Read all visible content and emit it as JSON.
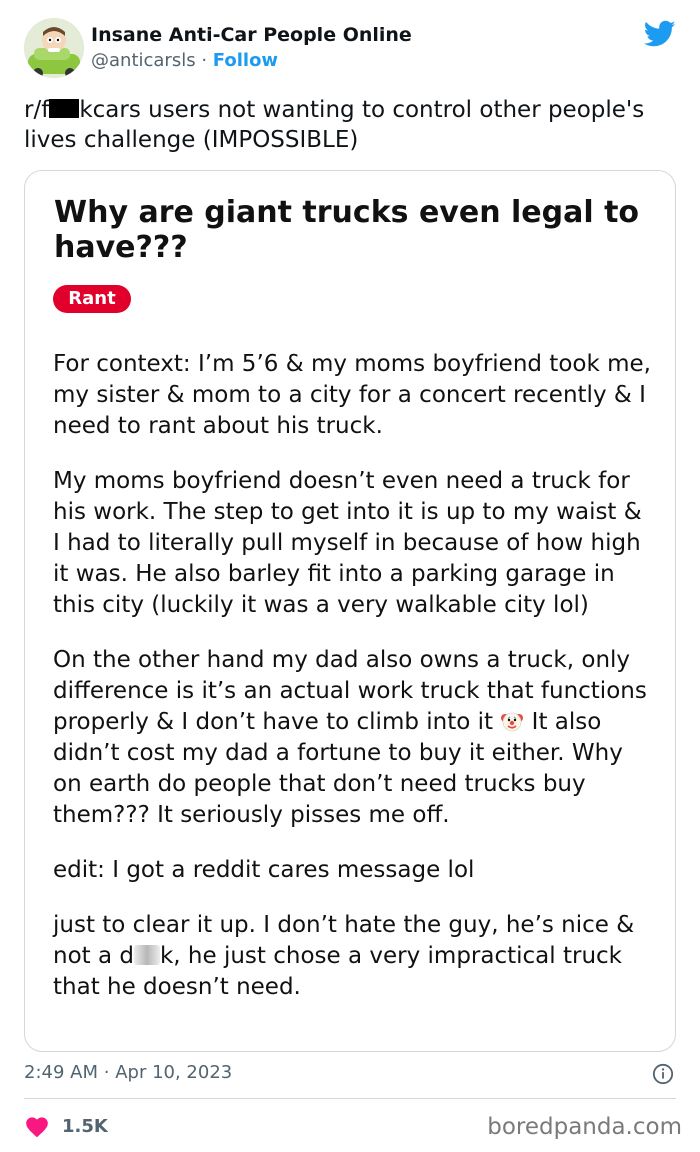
{
  "header": {
    "display_name": "Insane Anti-Car People Online",
    "handle": "@anticarsls",
    "separator": "·",
    "follow_label": "Follow",
    "avatar_icon": "cartoon-character-in-car-avatar",
    "platform_icon": "twitter-bird-icon",
    "accent_color": "#1d9bf0"
  },
  "tweet": {
    "text_prefix": "r/f",
    "text_rest": "kcars users not wanting to control other people's lives challenge (IMPOSSIBLE)"
  },
  "post": {
    "title": "Why are giant trucks even legal to have???",
    "flair": "Rant",
    "flair_color": "#e0002b",
    "paragraphs": [
      "For context: I’m 5’6 & my moms boyfriend took me, my sister & mom to a city for a concert recently & I need to rant about his truck.",
      "My moms boyfriend doesn’t even need a truck for his work. The step to get into it is up to my waist & I had to literally pull myself in because of how high it was. He also barley fit into a parking garage in this city (luckily it was a very walkable city lol)"
    ],
    "p3_before_emoji": "On the other hand my dad also owns a truck, only difference is it’s an actual work truck that functions properly & I don’t have to climb into it",
    "p3_after_emoji": " It also didn’t cost my dad a fortune to buy it either. Why on earth do people that don’t need trucks buy them??? It seriously pisses me off.",
    "emoji_icon": "clown-face-icon",
    "edit": "edit: I got a reddit cares message lol",
    "p5_before_blur": "just to clear it up. I don’t hate the guy, he’s nice & not a d",
    "p5_after_blur": "k, he just chose a very impractical truck that he doesn’t need."
  },
  "footer": {
    "time": "2:49 AM",
    "separator": "·",
    "date": "Apr 10, 2023",
    "info_icon": "info-icon",
    "like_icon": "heart-icon",
    "like_color": "#f91880",
    "likes": "1.5K",
    "watermark": "boredpanda.com"
  }
}
